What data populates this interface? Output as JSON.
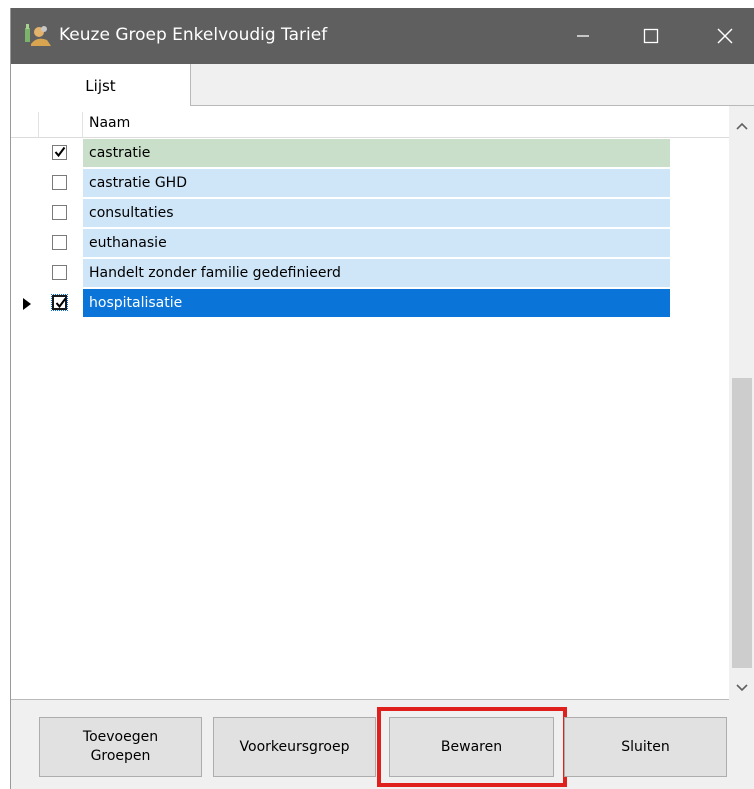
{
  "window": {
    "title": "Keuze Groep Enkelvoudig Tarief"
  },
  "tabs": [
    {
      "label": "Lijst",
      "active": true
    }
  ],
  "grid": {
    "column_header": "Naam",
    "rows": [
      {
        "label": "castratie",
        "checked": true,
        "state": "green"
      },
      {
        "label": "castratie GHD",
        "checked": false,
        "state": "normal"
      },
      {
        "label": "consultaties",
        "checked": false,
        "state": "normal"
      },
      {
        "label": "euthanasie",
        "checked": false,
        "state": "normal"
      },
      {
        "label": "Handelt zonder familie gedefinieerd",
        "checked": false,
        "state": "normal"
      },
      {
        "label": "hospitalisatie",
        "checked": true,
        "state": "selected",
        "current": true
      }
    ]
  },
  "buttons": {
    "toevoegen_line1": "Toevoegen",
    "toevoegen_line2": "Groepen",
    "voorkeursgroep": "Voorkeursgroep",
    "bewaren": "Bewaren",
    "sluiten": "Sluiten"
  },
  "colors": {
    "titlebar": "#5f5f5f",
    "row_normal": "#cfe6f8",
    "row_green": "#c9dfc9",
    "row_selected": "#0a74d8",
    "highlight": "#e0201c"
  },
  "icons": {
    "app": "app-icon",
    "minimize": "minimize-icon",
    "maximize": "maximize-icon",
    "close": "close-icon",
    "row_pointer": "row-pointer-icon",
    "checkmark": "checkmark-icon",
    "scroll_up": "chevron-up-icon",
    "scroll_down": "chevron-down-icon"
  }
}
